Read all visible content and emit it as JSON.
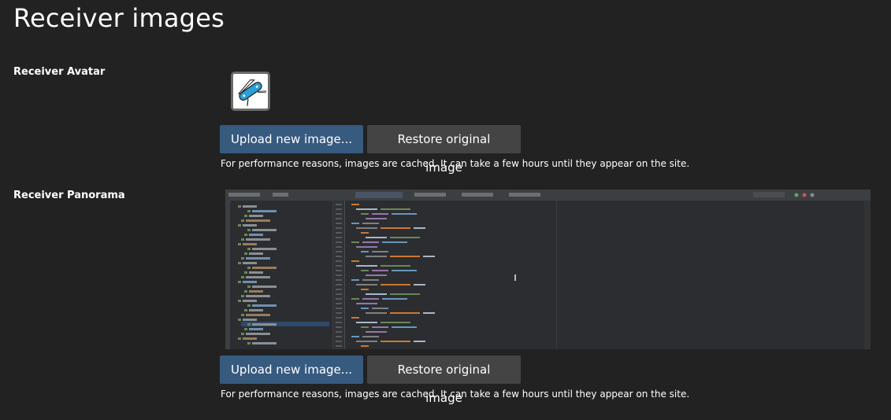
{
  "page": {
    "title": "Receiver images"
  },
  "avatar": {
    "label": "Receiver Avatar",
    "upload_label": "Upload new image...",
    "restore_label": "Restore original image",
    "help": "For performance reasons, images are cached. It can take a few hours until they appear on the site."
  },
  "panorama": {
    "label": "Receiver Panorama",
    "upload_label": "Upload new image...",
    "restore_label": "Restore original image",
    "help": "For performance reasons, images are cached. It can take a few hours until they appear on the site."
  },
  "colors": {
    "background": "#222222",
    "primary": "#375a7f",
    "secondary": "#444444",
    "avatar_icon": "#29a0d8"
  },
  "icons": {
    "avatar": "swiss-army-knife-icon"
  }
}
